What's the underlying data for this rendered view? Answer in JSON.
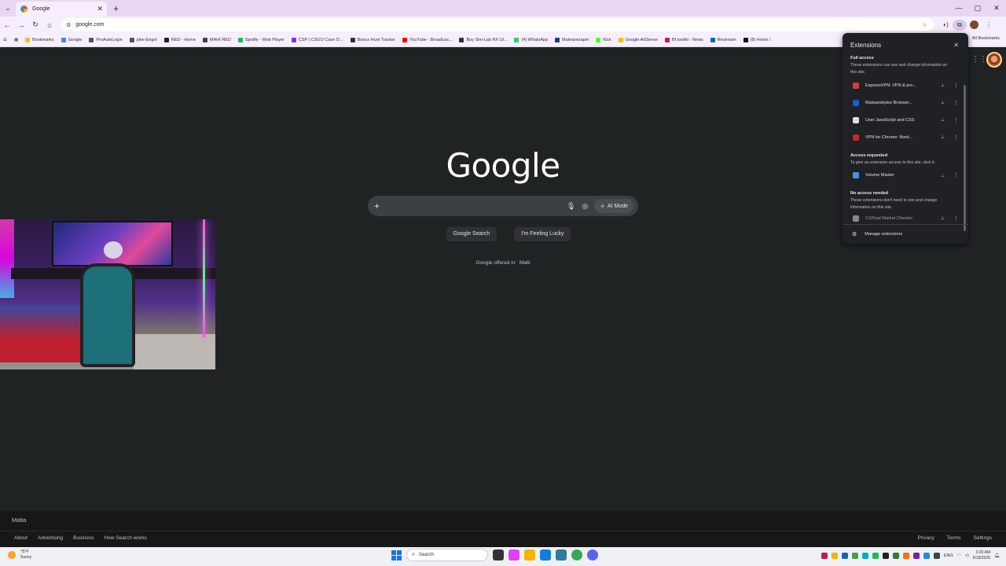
{
  "browser": {
    "tab_title": "Google",
    "address": "google.com",
    "bookmarks": [
      "Bookmarks",
      "Google",
      "ProAutoLogin",
      "joke-Engel",
      "RED - Home",
      "MAHI RED",
      "Spotify - Web Player",
      "CSP | CSGO Case O...",
      "Bonus Hunt Tracker",
      "YouTube - Broadcas...",
      "Buy Sim-Lab RX Ul...",
      "(4) WhatsApp",
      "Malwarezapm",
      "Kick",
      "Google AdSense",
      "BI toolkit - News",
      "Restream",
      "(8) Home /"
    ],
    "bookmark_colors": [
      "#f2c200",
      "#4285f4",
      "#555555",
      "#555555",
      "#222222",
      "#444444",
      "#1db954",
      "#8a2be2",
      "#333333",
      "#ff0000",
      "#333333",
      "#25d366",
      "#1a3a8a",
      "#53fc18",
      "#fbbc05",
      "#c2185b",
      "#1565c0",
      "#111111"
    ],
    "all_bookmarks": "All Bookmarks"
  },
  "google": {
    "logo": "Google",
    "search_placeholder": "",
    "ai_mode": "AI Mode",
    "search_button": "Google Search",
    "lucky_button": "I'm Feeling Lucky",
    "offered_in": "Google offered in:",
    "offered_lang": "Malti"
  },
  "extensions": {
    "title": "Extensions",
    "full_access_title": "Full access",
    "full_access_desc": "These extensions can see and change information on this site.",
    "full_access_items": [
      {
        "name": "ExpressVPN: VPN & pro...",
        "color": "#da3940"
      },
      {
        "name": "Malwarebytes Browser...",
        "color": "#1a5ad6"
      },
      {
        "name": "User JavaScript and CSS",
        "color": "#dddddd"
      },
      {
        "name": "VPN for Chrome: Nord...",
        "color": "#c62828"
      }
    ],
    "access_requested_title": "Access requested",
    "access_requested_desc": "To give an extension access to this site, click it.",
    "access_requested_items": [
      {
        "name": "Volume Master",
        "color": "#4a90e2"
      }
    ],
    "no_access_title": "No access needed",
    "no_access_desc": "These extensions don't need to see and change information on this site.",
    "no_access_items": [
      {
        "name": "CSFloat Market Checker",
        "color": "#888888"
      }
    ],
    "manage": "Manage extensions"
  },
  "footer": {
    "country": "Malta",
    "links_left": [
      "About",
      "Advertising",
      "Business",
      "How Search works"
    ],
    "links_right": [
      "Privacy",
      "Terms",
      "Settings"
    ]
  },
  "taskbar": {
    "temp": "75°F",
    "weather": "Sunny",
    "search": "Search",
    "lang": "ENG",
    "time": "3:20 AM",
    "date": "6/18/2026",
    "app_colors": [
      "#333333",
      "#e040fb",
      "#f4b400",
      "#0f7fd8",
      "#2d7d9a",
      "#34a853",
      "#5865f2"
    ],
    "tray_colors": [
      "#c2185b",
      "#f4b400",
      "#1565c0",
      "#43a047",
      "#00acc1",
      "#1db954",
      "#222222",
      "#2e7d32",
      "#ff6d00",
      "#7b1fa2",
      "#1e88e5",
      "#444444"
    ]
  }
}
